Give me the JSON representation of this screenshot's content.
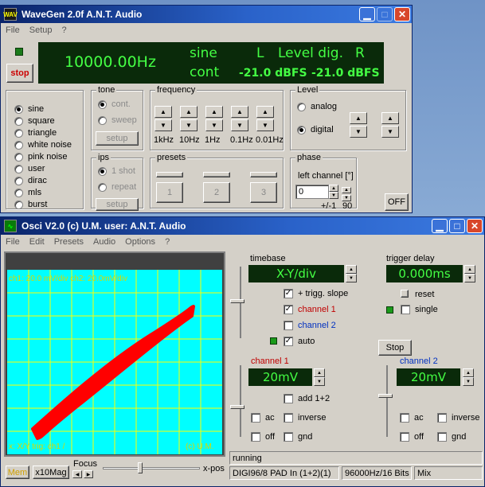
{
  "wavegen": {
    "title": "WaveGen 2.0f  A.N.T. Audio",
    "icon_text": "WAV",
    "menu": [
      "File",
      "Setup",
      "?"
    ],
    "stop_label": "stop",
    "display": {
      "frequency": "10000.00Hz",
      "waveform": "sine",
      "mode": "cont",
      "left": "L",
      "level_label": "Level dig.",
      "right": "R",
      "level_l": "-21.0 dBFS",
      "level_r": "-21.0 dBFS"
    },
    "waveforms": [
      {
        "label": "sine",
        "selected": true
      },
      {
        "label": "square",
        "selected": false
      },
      {
        "label": "triangle",
        "selected": false
      },
      {
        "label": "white noise",
        "selected": false
      },
      {
        "label": "pink noise",
        "selected": false
      },
      {
        "label": "user",
        "selected": false
      },
      {
        "label": "dirac",
        "selected": false
      },
      {
        "label": "mls",
        "selected": false
      },
      {
        "label": "burst",
        "selected": false
      }
    ],
    "tone": {
      "label": "tone",
      "cont": "cont.",
      "sweep": "sweep",
      "setup": "setup"
    },
    "frequency": {
      "label": "frequency",
      "steps": [
        "1kHz",
        "10Hz",
        "1Hz",
        "0.1Hz",
        "0.01Hz"
      ]
    },
    "level": {
      "label": "Level",
      "analog": "analog",
      "digital": "digital"
    },
    "ips": {
      "label": "ips",
      "shot": "1 shot",
      "repeat": "repeat",
      "setup": "setup"
    },
    "presets": {
      "label": "presets",
      "items": [
        "1",
        "2",
        "3"
      ]
    },
    "phase": {
      "label": "phase",
      "left_channel": "left channel [°]",
      "value": "0",
      "pm": "+/-1",
      "ninety": "90"
    },
    "off_label": "OFF"
  },
  "osci": {
    "title": "Osci V2.0  (c) U.M.  user: A.N.T. Audio",
    "menu": [
      "File",
      "Edit",
      "Presets",
      "Audio",
      "Options",
      "?"
    ],
    "screen": {
      "top_text": "ch1: 20.0 mV/div  ch2: 20.0mV/div",
      "bottom_text": "x: X/Y  trig: ch1 /",
      "copyright": "(c) U.M.",
      "grid_color": "#ffff00",
      "bg_color": "#00ffff",
      "trace_color": "#ff0000"
    },
    "bottom": {
      "mem": "Mem",
      "x10": "x10Mag",
      "focus": "Focus",
      "xpos": "x-pos"
    },
    "timebase": {
      "label": "timebase",
      "value": "X-Y/div",
      "trigg_slope": "+ trigg. slope",
      "channel1": "channel 1",
      "channel2": "channel 2",
      "auto": "auto"
    },
    "trigger": {
      "label": "trigger delay",
      "value": "0.000ms",
      "reset": "reset",
      "single": "single"
    },
    "stop_label": "Stop",
    "ch1": {
      "label": "channel 1",
      "value": "20mV",
      "add": "add 1+2",
      "ac": "ac",
      "inverse": "inverse",
      "off": "off",
      "gnd": "gnd"
    },
    "ch2": {
      "label": "channel 2",
      "value": "20mV",
      "ac": "ac",
      "inverse": "inverse",
      "off": "off",
      "gnd": "gnd"
    },
    "status": {
      "running": "running",
      "device": "DIGI96/8 PAD In (1+2)(1)",
      "format": "96000Hz/16 Bits",
      "mix": "Mix"
    }
  }
}
